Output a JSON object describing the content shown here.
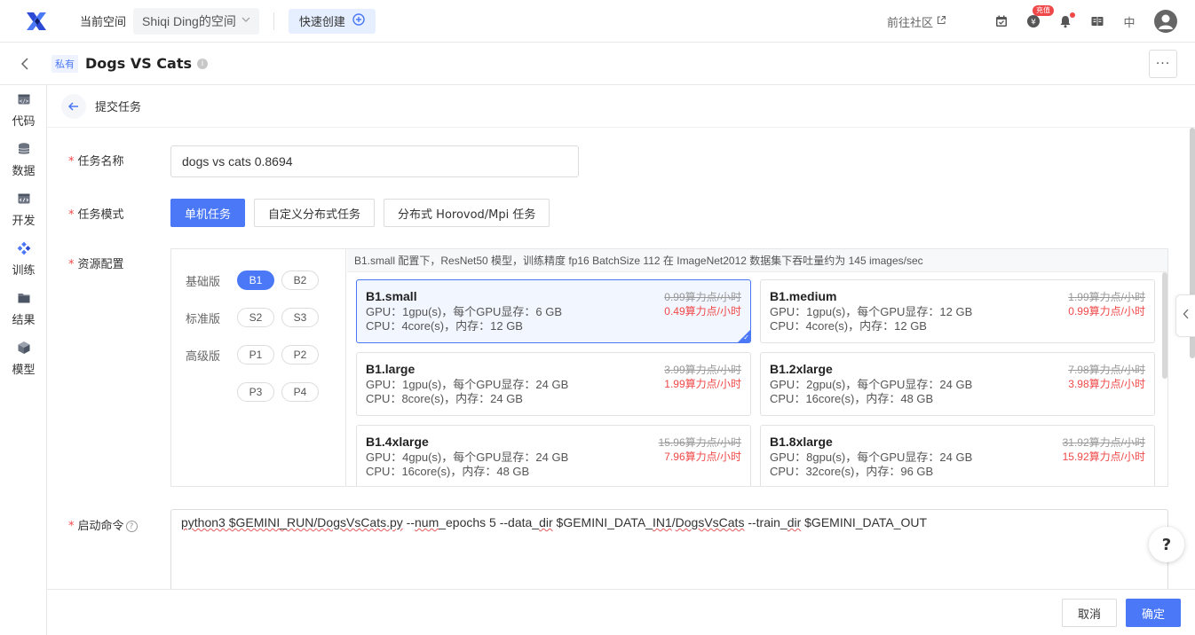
{
  "header": {
    "space_label": "当前空间",
    "space_name": "Shiqi Ding的空间",
    "quick_create": "快速创建",
    "community": "前往社区",
    "recharge_badge": "充值",
    "lang": "中"
  },
  "titlebar": {
    "private_tag": "私有",
    "title": "Dogs VS Cats",
    "more": "···"
  },
  "sidebar": {
    "items": [
      {
        "label": "代码",
        "icon": "code-icon"
      },
      {
        "label": "数据",
        "icon": "database-icon"
      },
      {
        "label": "开发",
        "icon": "dev-icon"
      },
      {
        "label": "训练",
        "icon": "training-icon"
      },
      {
        "label": "结果",
        "icon": "folder-icon"
      },
      {
        "label": "模型",
        "icon": "cube-icon"
      }
    ]
  },
  "breadcrumb": "提交任务",
  "form": {
    "name_label": "任务名称",
    "name_value": "dogs vs  cats 0.8694",
    "mode_label": "任务模式",
    "modes": [
      "单机任务",
      "自定义分布式任务",
      "分布式 Horovod/Mpi 任务"
    ],
    "resource_label": "资源配置",
    "tiers": [
      {
        "name": "基础版",
        "options": [
          "B1",
          "B2"
        ]
      },
      {
        "name": "标准版",
        "options": [
          "S2",
          "S3"
        ]
      },
      {
        "name": "高级版",
        "options": [
          "P1",
          "P2"
        ]
      },
      {
        "name": "",
        "options": [
          "P3",
          "P4"
        ]
      }
    ],
    "spec_header": "B1.small 配置下，ResNet50 模型，训练精度 fp16 BatchSize 112 在 ImageNet2012 数据集下吞吐量约为 145 images/sec",
    "specs": [
      {
        "name": "B1.small",
        "gpu": "GPU：1gpu(s)，每个GPU显存：6 GB",
        "cpu": "CPU：4core(s)，内存：12 GB",
        "old_price": "0.99",
        "new_price": "0.49算力点/小时",
        "unit": "算力点/小时"
      },
      {
        "name": "B1.medium",
        "gpu": "GPU：1gpu(s)，每个GPU显存：12 GB",
        "cpu": "CPU：4core(s)，内存：12 GB",
        "old_price": "1.99",
        "new_price": "0.99算力点/小时",
        "unit": "算力点/小时"
      },
      {
        "name": "B1.large",
        "gpu": "GPU：1gpu(s)，每个GPU显存：24 GB",
        "cpu": "CPU：8core(s)，内存：24 GB",
        "old_price": "3.99",
        "new_price": "1.99算力点/小时",
        "unit": "算力点/小时"
      },
      {
        "name": "B1.2xlarge",
        "gpu": "GPU：2gpu(s)，每个GPU显存：24 GB",
        "cpu": "CPU：16core(s)，内存：48 GB",
        "old_price": "7.98",
        "new_price": "3.98算力点/小时",
        "unit": "算力点/小时"
      },
      {
        "name": "B1.4xlarge",
        "gpu": "GPU：4gpu(s)，每个GPU显存：24 GB",
        "cpu": "CPU：16core(s)，内存：48 GB",
        "old_price": "15.96",
        "new_price": "7.96算力点/小时",
        "unit": "算力点/小时"
      },
      {
        "name": "B1.8xlarge",
        "gpu": "GPU：8gpu(s)，每个GPU显存：24 GB",
        "cpu": "CPU：32core(s)，内存：96 GB",
        "old_price": "31.92",
        "new_price": "15.92算力点/小时",
        "unit": "算力点/小时"
      }
    ],
    "command_label": "启动命令",
    "command": {
      "p1": "python3 $GEMINI_RUN/",
      "p2": "DogsVsCats.py",
      "p3": " --",
      "p4": "num",
      "p5": "_epochs 5 --data_",
      "p6": "dir",
      "p7": " $GEMINI_DATA_",
      "p8": "IN1",
      "p9": "/",
      "p10": "DogsVsCats",
      "p11": " --train_",
      "p12": "dir",
      "p13": " $GEMINI_DATA_OUT"
    }
  },
  "footer": {
    "cancel": "取消",
    "confirm": "确定"
  },
  "help": "?",
  "colors": {
    "accent": "#4a78f6",
    "danger": "#f04848"
  }
}
